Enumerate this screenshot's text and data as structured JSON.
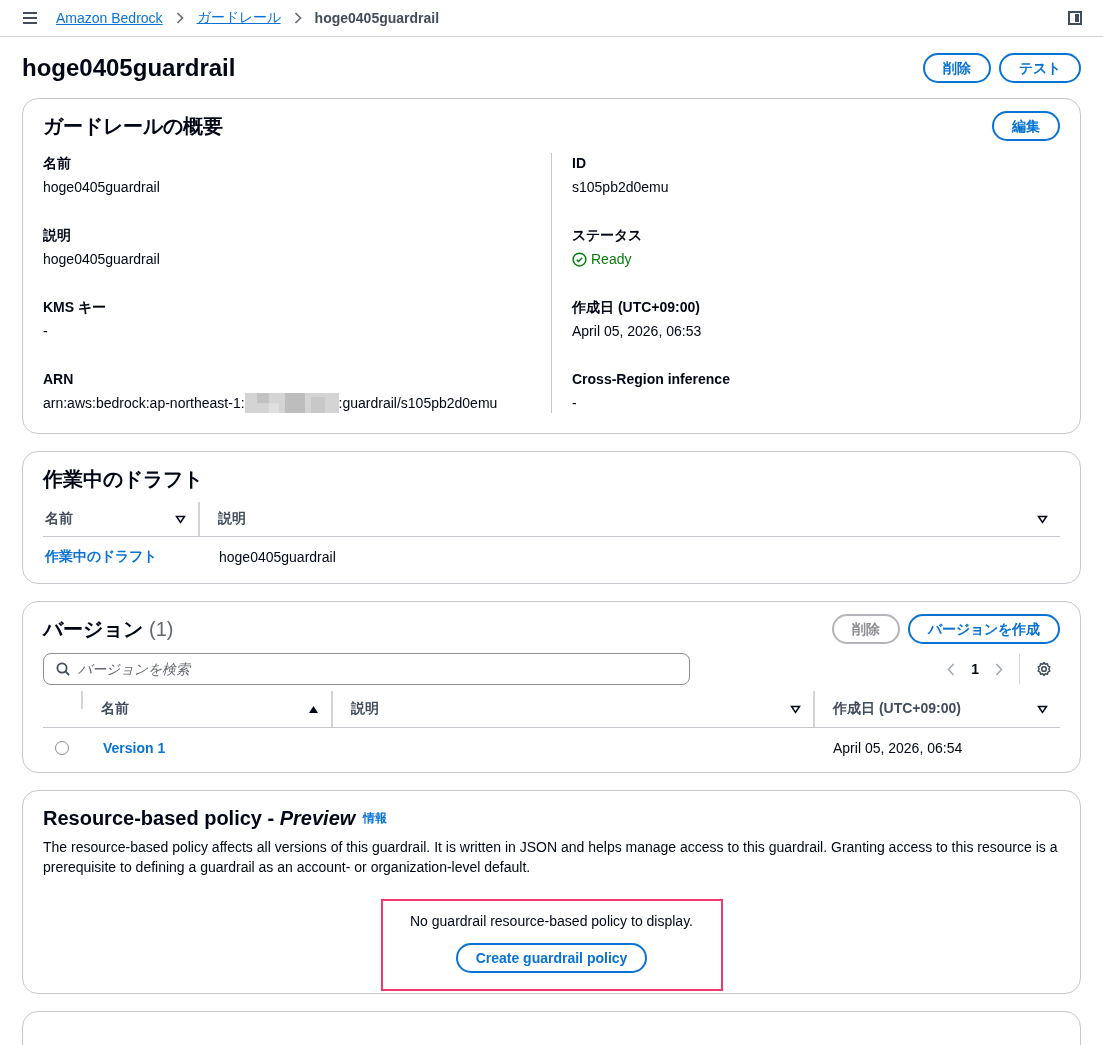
{
  "breadcrumbs": [
    {
      "label": "Amazon Bedrock",
      "link": true
    },
    {
      "label": "ガードレール",
      "link": true
    },
    {
      "label": "hoge0405guardrail",
      "link": false
    }
  ],
  "page": {
    "title": "hoge0405guardrail",
    "actions": [
      {
        "label": "削除",
        "disabled": false
      },
      {
        "label": "テスト",
        "disabled": false
      }
    ]
  },
  "overview": {
    "title": "ガードレールの概要",
    "edit_button": "編集",
    "left": [
      {
        "label": "名前",
        "kind": "text",
        "value": "hoge0405guardrail"
      },
      {
        "label": "説明",
        "kind": "text",
        "value": "hoge0405guardrail"
      },
      {
        "label": "KMS キー",
        "kind": "text",
        "value": "-"
      },
      {
        "label": "ARN",
        "kind": "redacted",
        "value": "arn:aws:bedrock:ap-northeast-1:",
        "value_after": ":guardrail/s105pb2d0emu"
      }
    ],
    "right": [
      {
        "label": "ID",
        "kind": "text",
        "value": "s105pb2d0emu"
      },
      {
        "label": "ステータス",
        "kind": "status",
        "value": "Ready"
      },
      {
        "label": "作成日 (UTC+09:00)",
        "kind": "text",
        "value": "April 05, 2026, 06:53"
      },
      {
        "label": "Cross-Region inference",
        "kind": "text",
        "value": "-"
      }
    ]
  },
  "draft": {
    "title": "作業中のドラフト",
    "columns": [
      {
        "label": "名前",
        "sorted": false
      },
      {
        "label": "説明",
        "sorted": false
      }
    ],
    "rows": [
      {
        "name": "作業中のドラフト",
        "description": "hoge0405guardrail"
      }
    ]
  },
  "versions": {
    "title": "バージョン",
    "count": "(1)",
    "buttons": [
      {
        "label": "削除",
        "disabled": true
      },
      {
        "label": "バージョンを作成",
        "disabled": false
      }
    ],
    "search": {
      "placeholder": "バージョンを検索"
    },
    "pagination": {
      "pages": [
        {
          "label": "1",
          "selected": true
        }
      ]
    },
    "columns": [
      {
        "label": "名前",
        "sorted": true
      },
      {
        "label": "説明",
        "sorted": false
      },
      {
        "label": "作成日 (UTC+09:00)",
        "sorted": false
      }
    ],
    "rows": [
      {
        "name": "Version 1",
        "created": "April 05, 2026, 06:54",
        "selected": false
      }
    ]
  },
  "policy": {
    "title": "Resource-based policy - *Preview*",
    "info_link": "情報",
    "description": "The resource-based policy affects all versions of this guardrail. It is written in JSON and helps manage access to this guardrail. Granting access to this resource is a prerequisite to defining a guardrail as an account- or organization-level default.",
    "empty": {
      "message": "No guardrail resource-based policy to display.",
      "button": "Create guardrail policy",
      "highlighted": true
    }
  }
}
